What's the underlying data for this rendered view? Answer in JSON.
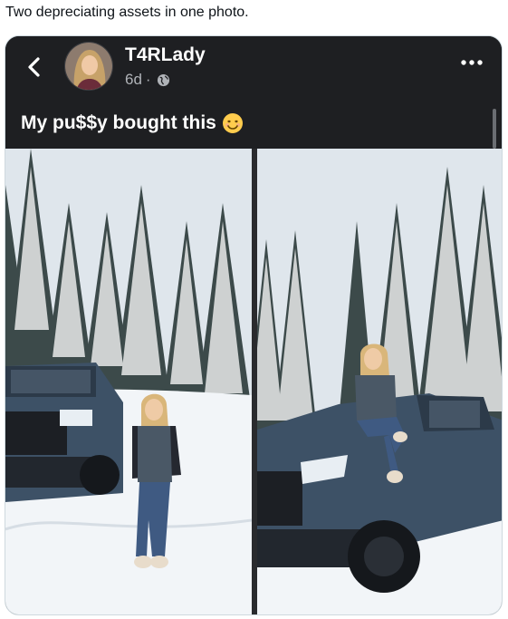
{
  "tweet": {
    "text": "Two depreciating assets in one photo."
  },
  "post": {
    "username": "T4RLady",
    "age": "6d",
    "separator": "·",
    "caption": "My pu$$y bought this"
  },
  "icons": {
    "back": "chevron-left-icon",
    "privacy": "globe-icon",
    "more": "more-horizontal-icon",
    "emoji": "smiling-face-icon"
  },
  "colors": {
    "post_background": "#1e1f22",
    "truck": "#3d5166",
    "snow": "#f2f5f8",
    "sky": "#dfe6ec"
  }
}
